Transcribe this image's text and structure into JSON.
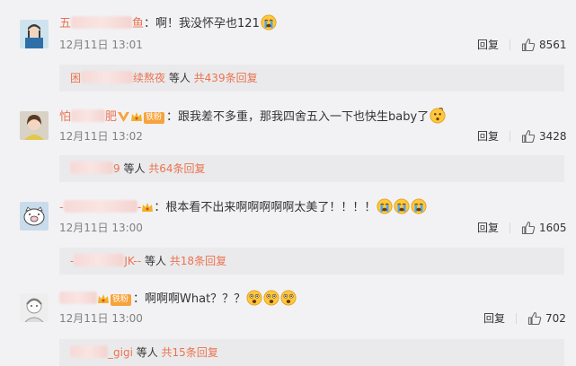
{
  "comments": [
    {
      "username_visible_start": "五",
      "username_visible_end": "鱼",
      "text": "：啊！我没怀孕也121",
      "time": "12月11日 13:01",
      "reply_label": "回复",
      "likes": "8561",
      "replies_summary": {
        "names_visible_start": "困",
        "names_visible_end": "续熬夜",
        "suffix": " 等人 ",
        "count_text": "共439条回复"
      },
      "emoji": [
        "crying-face"
      ]
    },
    {
      "username_visible_start": "怕",
      "username_visible_end": "肥",
      "badge_text": "铁粉",
      "text": "：跟我差不多重，那我四舍五入一下也快生baby了",
      "time": "12月11日 13:02",
      "reply_label": "回复",
      "likes": "3428",
      "replies_summary": {
        "names_visible_end": "9",
        "suffix": " 等人 ",
        "count_text": "共64条回复"
      },
      "emoji": [
        "thinking-face"
      ]
    },
    {
      "username_visible_start": "-",
      "username_visible_end": "-",
      "text": "：根本看不出来啊啊啊啊啊太美了！！！！",
      "time": "12月11日 13:00",
      "reply_label": "回复",
      "likes": "1605",
      "replies_summary": {
        "names_visible_start": "-",
        "names_visible_end": "JK--",
        "suffix": " 等人 ",
        "count_text": "共18条回复"
      },
      "emoji": [
        "crying-face",
        "crying-face",
        "crying-face"
      ]
    },
    {
      "username_visible_start": "",
      "username_visible_end": "",
      "badge_text": "铁粉",
      "text": "：啊啊啊What？？？",
      "time": "12月11日 13:00",
      "reply_label": "回复",
      "likes": "702",
      "replies_summary": {
        "names_visible_end": "_gigi",
        "suffix": " 等人 ",
        "count_text": "共15条回复"
      },
      "emoji": [
        "shocked-face",
        "shocked-face",
        "shocked-face"
      ]
    }
  ],
  "colors": {
    "username": "#eb7350",
    "reply_box": "#eaeaec",
    "background": "#f2f2f5",
    "badge": "#f7a23b"
  }
}
